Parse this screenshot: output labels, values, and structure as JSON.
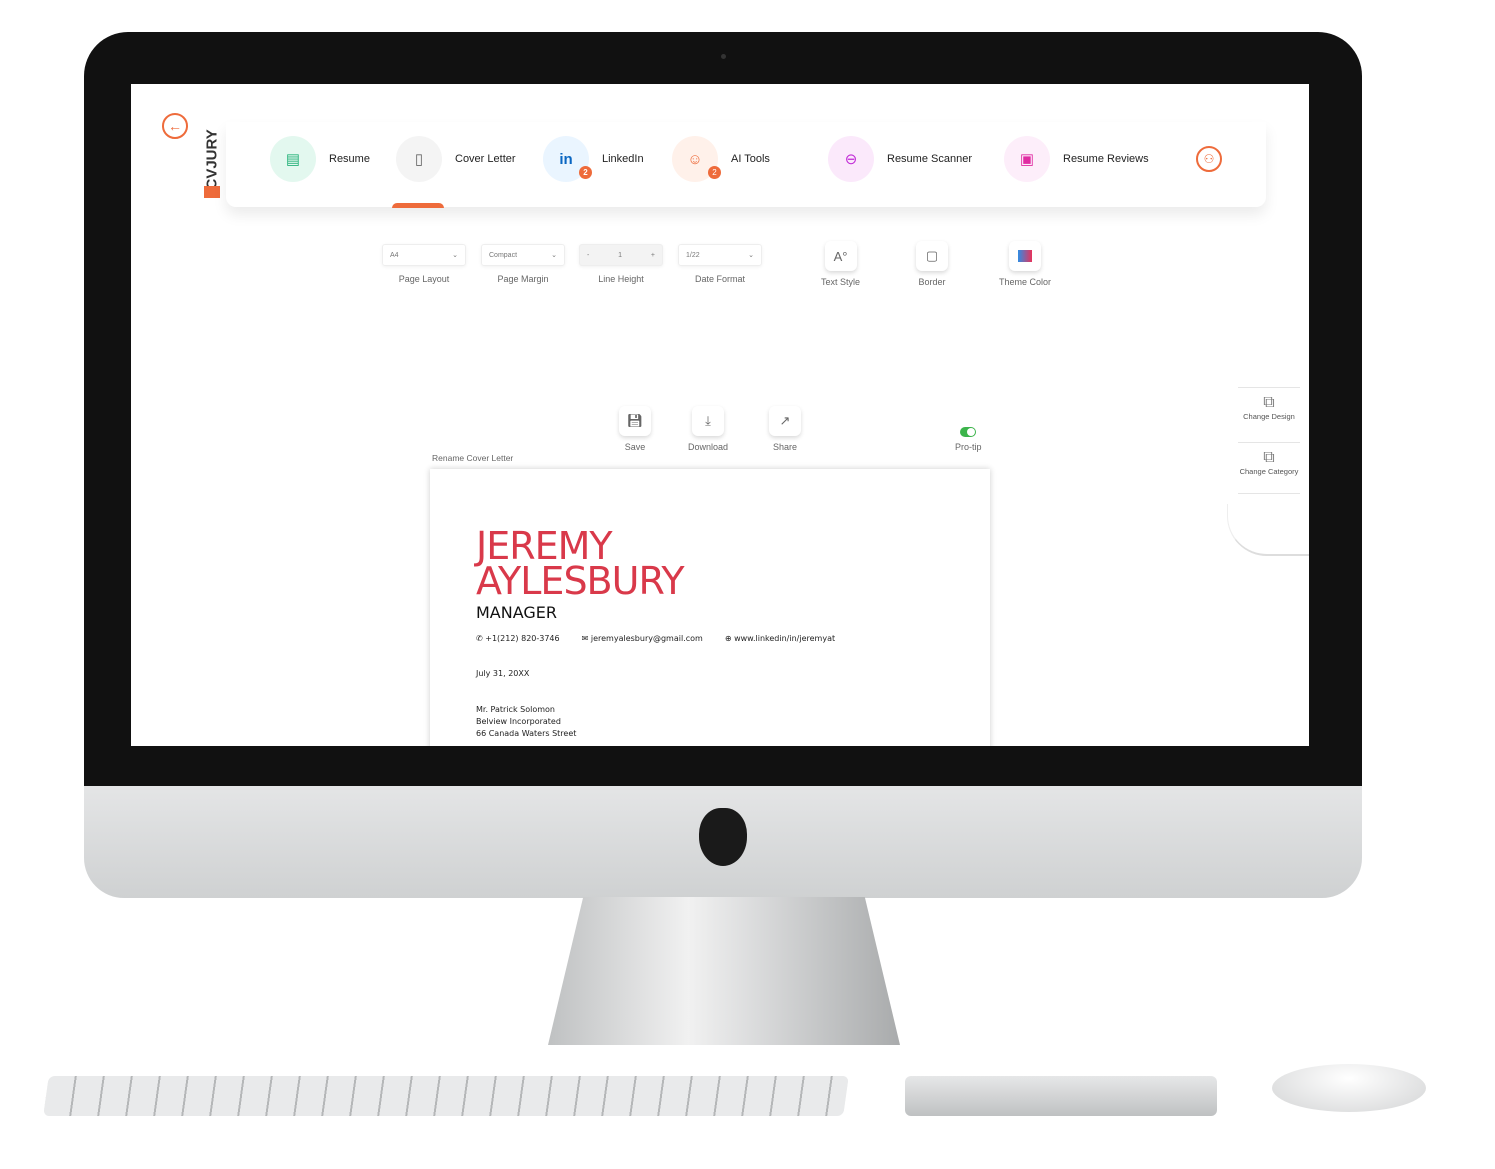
{
  "brand": {
    "logo": "CVJURY",
    "accent": "#ee6b3b"
  },
  "nav": [
    {
      "label": "Resume",
      "icon": "resume-doc-icon",
      "bg": "#e3f8ef",
      "color": "#27b27a"
    },
    {
      "label": "Cover Letter",
      "icon": "cover-letter-icon",
      "bg": "#f4f4f4",
      "color": "#666"
    },
    {
      "label": "LinkedIn",
      "icon": "linkedin-icon",
      "bg": "#eaf5ff",
      "color": "#0a66c2",
      "badge": "2"
    },
    {
      "label": "AI Tools",
      "icon": "robot-icon",
      "bg": "#fff1ea",
      "color": "#ee6b3b",
      "badge": "2"
    },
    {
      "label": "Resume Scanner",
      "icon": "scanner-icon",
      "bg": "#fbe9fb",
      "color": "#c12ad6"
    },
    {
      "label": "Resume Reviews",
      "icon": "review-icon",
      "bg": "#fdeefa",
      "color": "#e02ba2"
    }
  ],
  "controls": {
    "page_layout": {
      "value": "A4",
      "label": "Page Layout"
    },
    "page_margin": {
      "value": "Compact",
      "label": "Page Margin"
    },
    "line_height": {
      "minus": "-",
      "value": "1",
      "plus": "+",
      "label": "Line Height"
    },
    "date_format": {
      "value": "1/22",
      "label": "Date Format"
    },
    "text_style": "Text Style",
    "border": "Border",
    "theme_color": "Theme Color"
  },
  "actions": {
    "save": "Save",
    "download": "Download",
    "share": "Share",
    "protip": "Pro-tip",
    "protip_on": true
  },
  "rename": "Rename Cover Letter",
  "side": {
    "change_design": "Change Design",
    "change_category": "Change Category"
  },
  "letter": {
    "first": "JEREMY",
    "last": "AYLESBURY",
    "title": "MANAGER",
    "phone": "+1(212) 820-3746",
    "email": "jeremyalesbury@gmail.com",
    "web": "www.linkedin/in/jeremyat",
    "date": "July 31, 20XX",
    "recipient": [
      "Mr. Patrick Solomon",
      "Belview Incorporated",
      "66 Canada Waters Street"
    ]
  }
}
